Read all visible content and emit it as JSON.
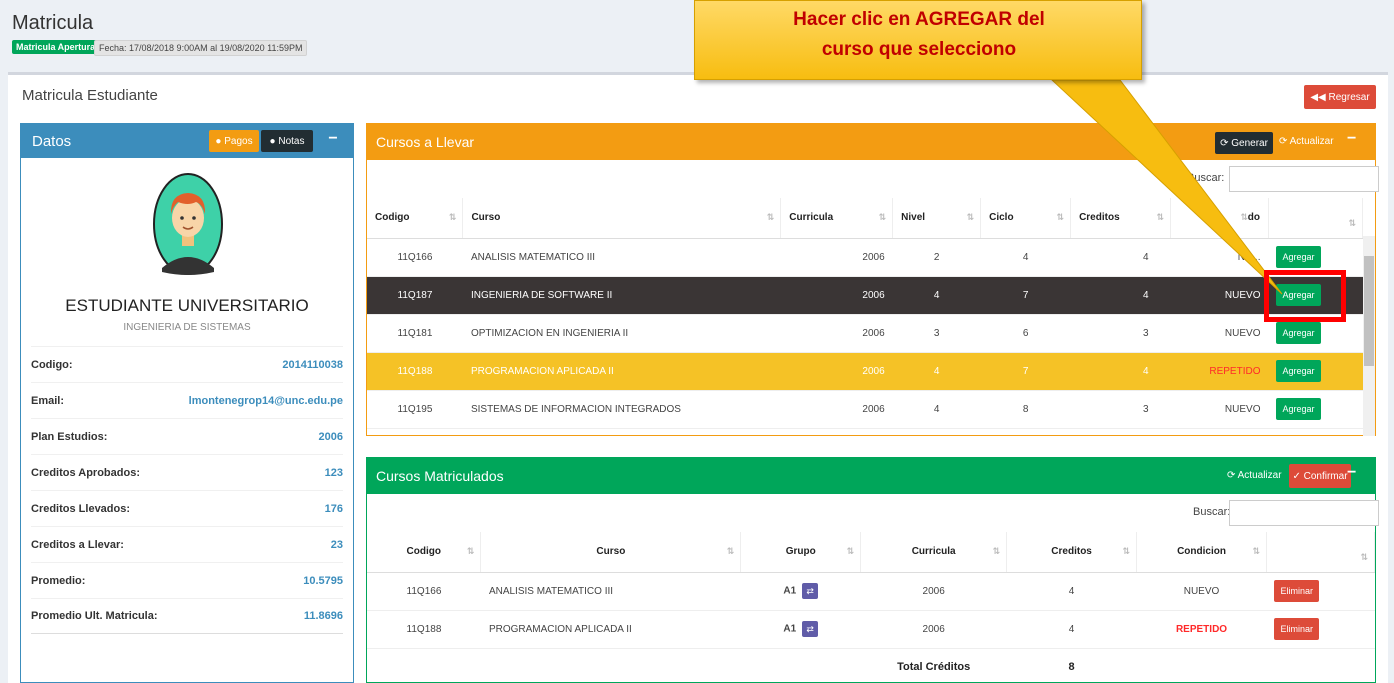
{
  "header": {
    "title": "Matricula",
    "status_badge": "Matricula Aperturada",
    "date_range": "Fecha: 17/08/2018 9:00AM al 19/08/2020 11:59PM"
  },
  "main": {
    "title": "Matricula Estudiante",
    "back_button": "Regresar"
  },
  "datos": {
    "title": "Datos",
    "pagos_button": "Pagos",
    "notas_button": "Notas",
    "collapse": "−",
    "student_name": "ESTUDIANTE UNIVERSITARIO",
    "career": "INGENIERIA DE SISTEMAS",
    "fields": [
      {
        "label": "Codigo:",
        "value": "2014110038"
      },
      {
        "label": "Email:",
        "value": "lmontenegrop14@unc.edu.pe"
      },
      {
        "label": "Plan Estudios:",
        "value": "2006"
      },
      {
        "label": "Creditos Aprobados:",
        "value": "123"
      },
      {
        "label": "Creditos Llevados:",
        "value": "176"
      },
      {
        "label": "Creditos a Llevar:",
        "value": "23"
      },
      {
        "label": "Promedio:",
        "value": "10.5795"
      },
      {
        "label": "Promedio Ult. Matricula:",
        "value": "11.8696"
      }
    ]
  },
  "llevar": {
    "title": "Cursos a Llevar",
    "generar_button": "Generar",
    "actualizar_link": "Actualizar",
    "collapse": "−",
    "search_label": "Buscar:",
    "columns": [
      "Codigo",
      "Curso",
      "Curricula",
      "Nivel",
      "Ciclo",
      "Creditos",
      "do",
      ""
    ],
    "rows": [
      {
        "codigo": "11Q166",
        "curso": "ANALISIS MATEMATICO III",
        "curricula": "2006",
        "nivel": "2",
        "ciclo": "4",
        "creditos": "4",
        "estado": "NU...",
        "action": "Agregar"
      },
      {
        "codigo": "11Q187",
        "curso": "INGENIERIA DE SOFTWARE II",
        "curricula": "2006",
        "nivel": "4",
        "ciclo": "7",
        "creditos": "4",
        "estado": "NUEVO",
        "action": "Agregar"
      },
      {
        "codigo": "11Q181",
        "curso": "OPTIMIZACION EN INGENIERIA II",
        "curricula": "2006",
        "nivel": "3",
        "ciclo": "6",
        "creditos": "3",
        "estado": "NUEVO",
        "action": "Agregar"
      },
      {
        "codigo": "11Q188",
        "curso": "PROGRAMACION APLICADA II",
        "curricula": "2006",
        "nivel": "4",
        "ciclo": "7",
        "creditos": "4",
        "estado": "REPETIDO",
        "action": "Agregar"
      },
      {
        "codigo": "11Q195",
        "curso": "SISTEMAS DE INFORMACION INTEGRADOS",
        "curricula": "2006",
        "nivel": "4",
        "ciclo": "8",
        "creditos": "3",
        "estado": "NUEVO",
        "action": "Agregar"
      }
    ]
  },
  "matriculados": {
    "title": "Cursos Matriculados",
    "actualizar_link": "Actualizar",
    "confirmar_button": "Confirmar",
    "collapse": "−",
    "search_label": "Buscar:",
    "columns": [
      "Codigo",
      "Curso",
      "Grupo",
      "Curricula",
      "Creditos",
      "Condicion",
      ""
    ],
    "rows": [
      {
        "codigo": "11Q166",
        "curso": "ANALISIS MATEMATICO III",
        "grupo": "A1",
        "curricula": "2006",
        "creditos": "4",
        "condicion": "NUEVO",
        "action": "Eliminar"
      },
      {
        "codigo": "11Q188",
        "curso": "PROGRAMACION APLICADA II",
        "grupo": "A1",
        "curricula": "2006",
        "creditos": "4",
        "condicion": "REPETIDO",
        "action": "Eliminar"
      }
    ],
    "total_label": "Total Créditos",
    "total_value": "8"
  },
  "callout": {
    "line1": "Hacer clic en AGREGAR del",
    "line2": "curso que selecciono"
  },
  "colors": {
    "primary": "#3c8dbc",
    "warning": "#f39c12",
    "success": "#00a65a",
    "danger": "#dd4b39",
    "highlight": "#ff0000"
  }
}
